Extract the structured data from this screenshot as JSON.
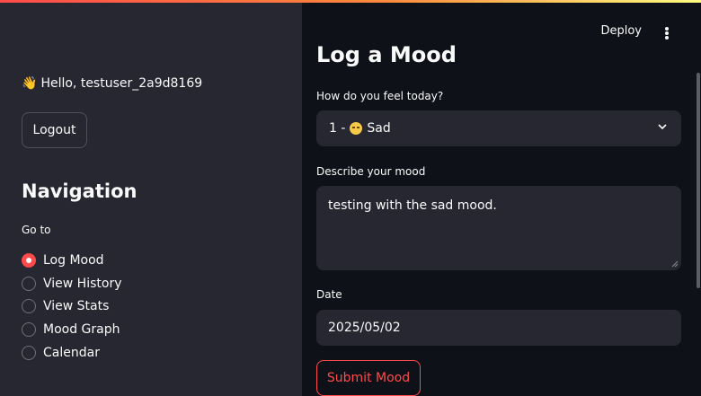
{
  "sidebar": {
    "greeting_emoji": "👋",
    "greeting": "Hello, testuser_2a9d8169",
    "logout_label": "Logout",
    "nav_title": "Navigation",
    "goto_label": "Go to",
    "items": [
      {
        "label": "Log Mood",
        "selected": true
      },
      {
        "label": "View History",
        "selected": false
      },
      {
        "label": "View Stats",
        "selected": false
      },
      {
        "label": "Mood Graph",
        "selected": false
      },
      {
        "label": "Calendar",
        "selected": false
      }
    ]
  },
  "header": {
    "deploy_label": "Deploy",
    "menu_icon": "kebab-menu-icon"
  },
  "main": {
    "title": "Log a Mood",
    "mood_label": "How do you feel today?",
    "mood_value_prefix": "1 -",
    "mood_value_emoji": "sad-face-icon",
    "mood_value_text": "Sad",
    "description_label": "Describe your mood",
    "description_value": "testing with the sad mood.",
    "date_label": "Date",
    "date_value": "2025/05/02",
    "submit_label": "Submit Mood"
  },
  "colors": {
    "accent": "#ff4b4b",
    "sidebar_bg": "#262730",
    "main_bg": "#0e1117",
    "input_bg": "#262730"
  }
}
